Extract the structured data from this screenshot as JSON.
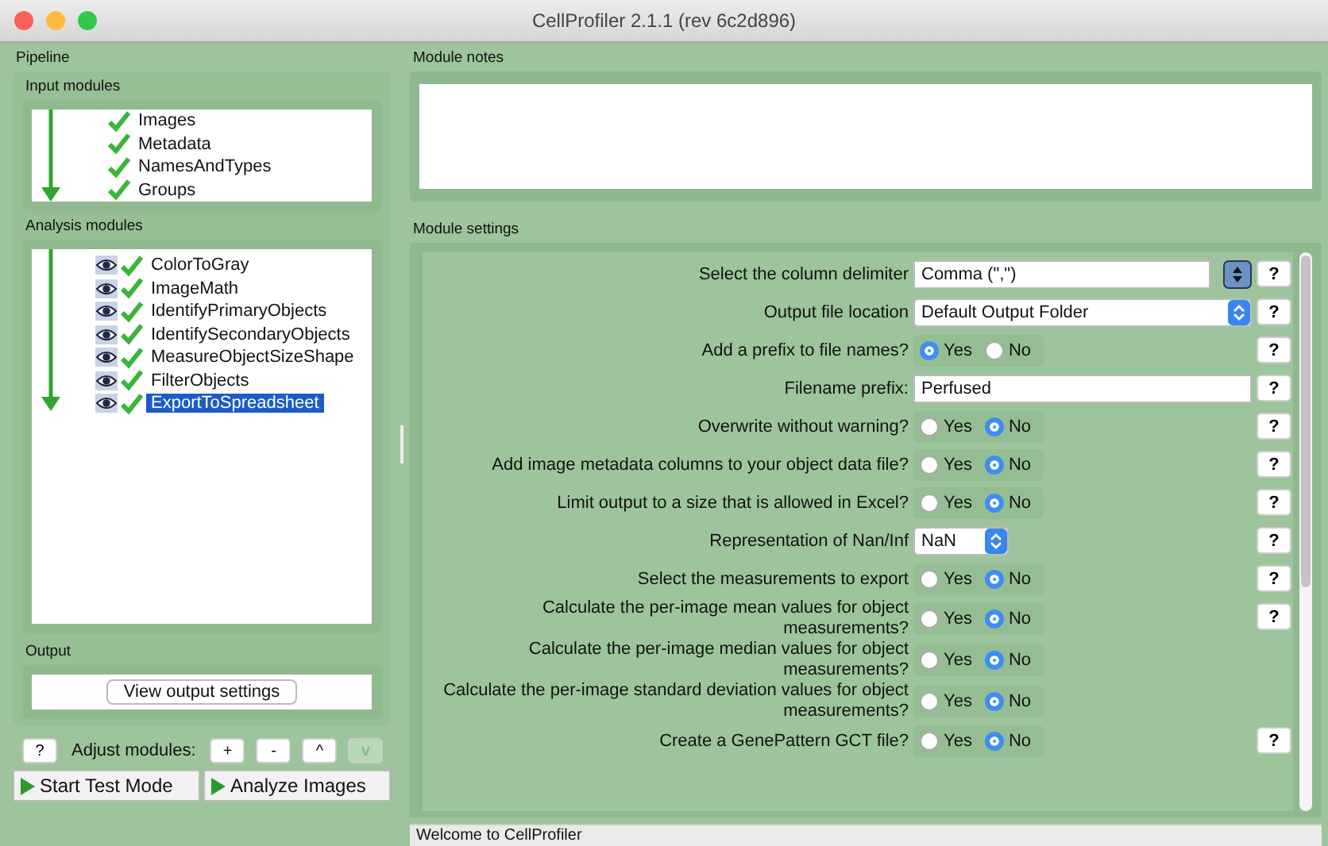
{
  "window": {
    "title": "CellProfiler 2.1.1 (rev 6c2d896)"
  },
  "pipeline": {
    "title": "Pipeline",
    "input_modules": {
      "title": "Input modules",
      "items": [
        {
          "name": "Images",
          "selected": false
        },
        {
          "name": "Metadata",
          "selected": false
        },
        {
          "name": "NamesAndTypes",
          "selected": false
        },
        {
          "name": "Groups",
          "selected": false
        }
      ]
    },
    "analysis_modules": {
      "title": "Analysis modules",
      "items": [
        {
          "name": "ColorToGray",
          "selected": false
        },
        {
          "name": "ImageMath",
          "selected": false
        },
        {
          "name": "IdentifyPrimaryObjects",
          "selected": false
        },
        {
          "name": "IdentifySecondaryObjects",
          "selected": false
        },
        {
          "name": "MeasureObjectSizeShape",
          "selected": false
        },
        {
          "name": "FilterObjects",
          "selected": false
        },
        {
          "name": "ExportToSpreadsheet",
          "selected": true
        }
      ]
    },
    "output": {
      "title": "Output",
      "button": "View output settings"
    },
    "adjust": {
      "help": "?",
      "label": "Adjust modules:",
      "buttons": [
        {
          "label": "+",
          "disabled": false
        },
        {
          "label": "-",
          "disabled": false
        },
        {
          "label": "^",
          "disabled": false
        },
        {
          "label": "v",
          "disabled": true
        }
      ]
    },
    "run_buttons": [
      "Start Test Mode",
      "Analyze Images"
    ]
  },
  "module_notes": {
    "title": "Module notes"
  },
  "module_settings": {
    "title": "Module settings",
    "settings": [
      {
        "kind": "combo",
        "label": "Select the column delimiter",
        "value": "Comma (\",\")",
        "help": "?"
      },
      {
        "kind": "select",
        "label": "Output file location",
        "value": "Default Output Folder",
        "help": "?"
      },
      {
        "kind": "radio",
        "label": "Add a prefix to file names?",
        "options": [
          {
            "label": "Yes",
            "selected": true
          },
          {
            "label": "No",
            "selected": false
          }
        ],
        "help": "?"
      },
      {
        "kind": "text",
        "label": "Filename prefix:",
        "value": "Perfused",
        "help": "?"
      },
      {
        "kind": "radio",
        "label": "Overwrite without warning?",
        "options": [
          {
            "label": "Yes",
            "selected": false
          },
          {
            "label": "No",
            "selected": true
          }
        ],
        "help": "?"
      },
      {
        "kind": "radio",
        "label": "Add image metadata columns to your object data file?",
        "options": [
          {
            "label": "Yes",
            "selected": false
          },
          {
            "label": "No",
            "selected": true
          }
        ],
        "help": "?"
      },
      {
        "kind": "radio",
        "label": "Limit output to a size that is allowed in Excel?",
        "options": [
          {
            "label": "Yes",
            "selected": false
          },
          {
            "label": "No",
            "selected": true
          }
        ],
        "help": "?"
      },
      {
        "kind": "menu",
        "label": "Representation of Nan/Inf",
        "value": "NaN",
        "help": "?"
      },
      {
        "kind": "radio",
        "label": "Select the measurements to export",
        "options": [
          {
            "label": "Yes",
            "selected": false
          },
          {
            "label": "No",
            "selected": true
          }
        ],
        "help": "?"
      },
      {
        "kind": "radio",
        "label": "Calculate the per-image mean values for object measurements?",
        "options": [
          {
            "label": "Yes",
            "selected": false
          },
          {
            "label": "No",
            "selected": true
          }
        ],
        "help": "?"
      },
      {
        "kind": "radio",
        "label": "Calculate the per-image median values for object measurements?",
        "options": [
          {
            "label": "Yes",
            "selected": false
          },
          {
            "label": "No",
            "selected": true
          }
        ]
      },
      {
        "kind": "radio",
        "label": "Calculate the per-image standard deviation values for object measurements?",
        "options": [
          {
            "label": "Yes",
            "selected": false
          },
          {
            "label": "No",
            "selected": true
          }
        ]
      },
      {
        "kind": "radio",
        "label": "Create a GenePattern GCT file?",
        "options": [
          {
            "label": "Yes",
            "selected": false
          },
          {
            "label": "No",
            "selected": true
          }
        ],
        "help": "?"
      }
    ]
  },
  "status_bar": {
    "text": "Welcome to CellProfiler"
  }
}
